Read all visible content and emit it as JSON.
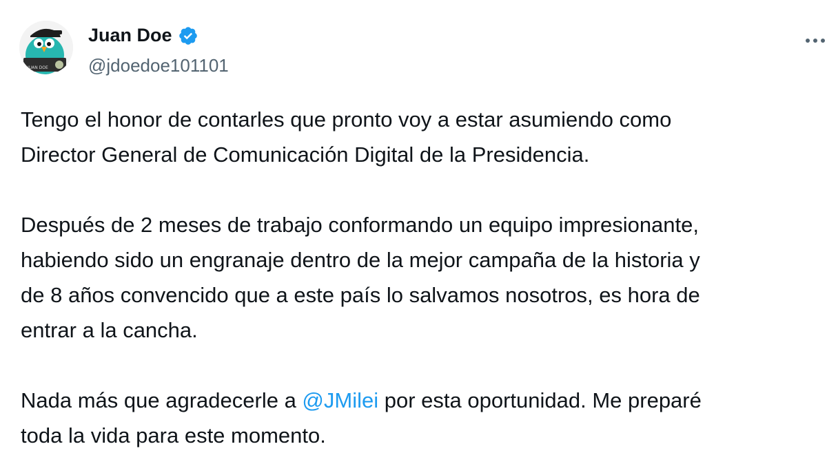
{
  "author": {
    "name": "Juan Doe",
    "handle": "@jdoedoe101101",
    "verified_icon": "verified-badge-icon",
    "avatar_caption": "JUAN DOE"
  },
  "menu": {
    "icon": "more-horizontal-icon"
  },
  "tweet": {
    "p1_l1": "Tengo el honor de contarles que pronto voy a estar asumiendo como",
    "p1_l2": "Director General de Comunicación Digital de la Presidencia.",
    "p2_l1": "Después de 2 meses de trabajo conformando un equipo impresionante,",
    "p2_l2": "habiendo sido un engranaje dentro de la mejor campaña de la historia y",
    "p2_l3": "de 8 años convencido que a este país lo salvamos nosotros, es hora de",
    "p2_l4": "entrar a la cancha.",
    "p3_l1_pre": "Nada más que agradecerle a ",
    "mention": "@JMilei",
    "p3_l1_post": " por esta oportunidad. Me preparé",
    "p3_l2": "toda la vida para este momento."
  },
  "colors": {
    "accent": "#1d9bf0",
    "text": "#0f1419",
    "muted": "#536471"
  }
}
